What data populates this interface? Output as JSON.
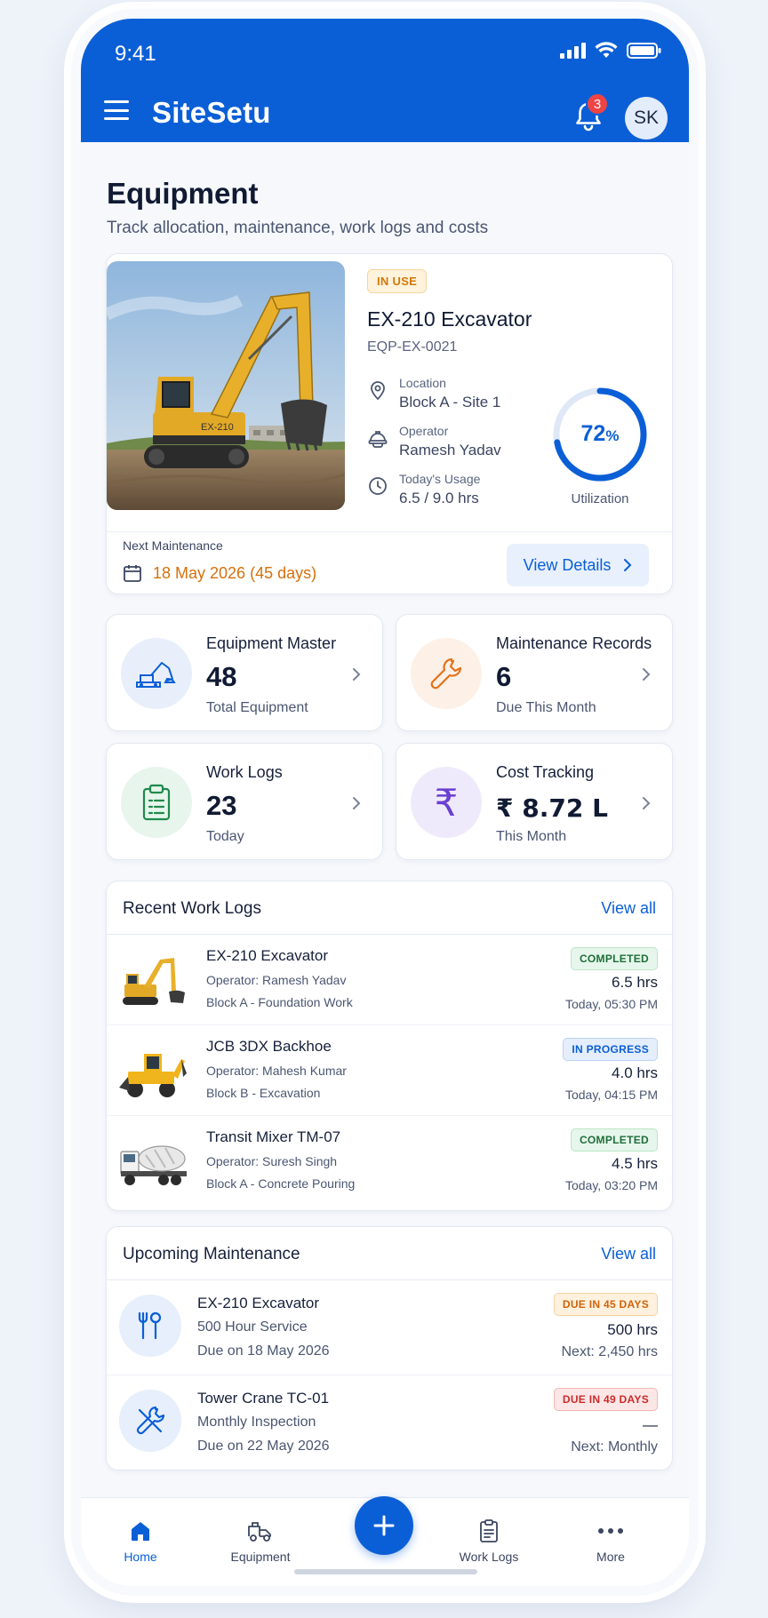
{
  "status_bar": {
    "time": "9:41"
  },
  "header": {
    "app_title": "SiteSetu",
    "notification_count": "3",
    "avatar_initials": "SK"
  },
  "page": {
    "title": "Equipment",
    "subtitle": "Track allocation, maintenance, work logs and costs"
  },
  "featured": {
    "status_badge": "IN USE",
    "name": "EX-210 Excavator",
    "code": "EQP-EX-0021",
    "location_label": "Location",
    "location_value": "Block A - Site 1",
    "operator_label": "Operator",
    "operator_value": "Ramesh Yadav",
    "usage_label": "Today's Usage",
    "usage_value": "6.5 / 9.0 hrs",
    "utilization_value": "72",
    "utilization_unit": "%",
    "utilization_fraction": 0.72,
    "utilization_label": "Utilization",
    "next_maintenance_label": "Next Maintenance",
    "next_maintenance_value": "18 May 2026 (45 days)",
    "view_details_label": "View Details"
  },
  "stats": [
    {
      "title": "Equipment Master",
      "value": "48",
      "sub": "Total Equipment",
      "icon": "excavator-icon"
    },
    {
      "title": "Maintenance Records",
      "value": "6",
      "sub": "Due This Month",
      "icon": "wrench-icon"
    },
    {
      "title": "Work Logs",
      "value": "23",
      "sub": "Today",
      "icon": "clipboard-icon"
    },
    {
      "title": "Cost Tracking",
      "value": "₹ 8.72 L",
      "sub": "This Month",
      "icon": "rupee-icon"
    }
  ],
  "recent_logs": {
    "title": "Recent Work Logs",
    "view_all": "View all",
    "items": [
      {
        "name": "EX-210 Excavator",
        "operator": "Operator: Ramesh Yadav",
        "site": "Block A - Foundation Work",
        "status": "COMPLETED",
        "hours": "6.5 hrs",
        "time": "Today, 05:30 PM"
      },
      {
        "name": "JCB 3DX Backhoe",
        "operator": "Operator: Mahesh Kumar",
        "site": "Block B - Excavation",
        "status": "IN PROGRESS",
        "hours": "4.0 hrs",
        "time": "Today, 04:15 PM"
      },
      {
        "name": "Transit Mixer TM-07",
        "operator": "Operator: Suresh Singh",
        "site": "Block A - Concrete Pouring",
        "status": "COMPLETED",
        "hours": "4.5 hrs",
        "time": "Today, 03:20 PM"
      }
    ]
  },
  "upcoming_maintenance": {
    "title": "Upcoming Maintenance",
    "view_all": "View all",
    "items": [
      {
        "name": "EX-210 Excavator",
        "service": "500 Hour Service",
        "due": "Due on 18 May 2026",
        "badge": "DUE IN 45 DAYS",
        "value": "500 hrs",
        "next": "Next: 2,450 hrs"
      },
      {
        "name": "Tower Crane TC-01",
        "service": "Monthly Inspection",
        "due": "Due on 22 May 2026",
        "badge": "DUE IN 49 DAYS",
        "value": "—",
        "next": "Next: Monthly"
      }
    ]
  },
  "bottom_nav": {
    "home": "Home",
    "equipment": "Equipment",
    "work_logs": "Work Logs",
    "more": "More"
  },
  "colors": {
    "primary": "#0b5fd6",
    "warning": "#d6700c",
    "success": "#1f6f3a",
    "danger": "#cc2b2b"
  }
}
